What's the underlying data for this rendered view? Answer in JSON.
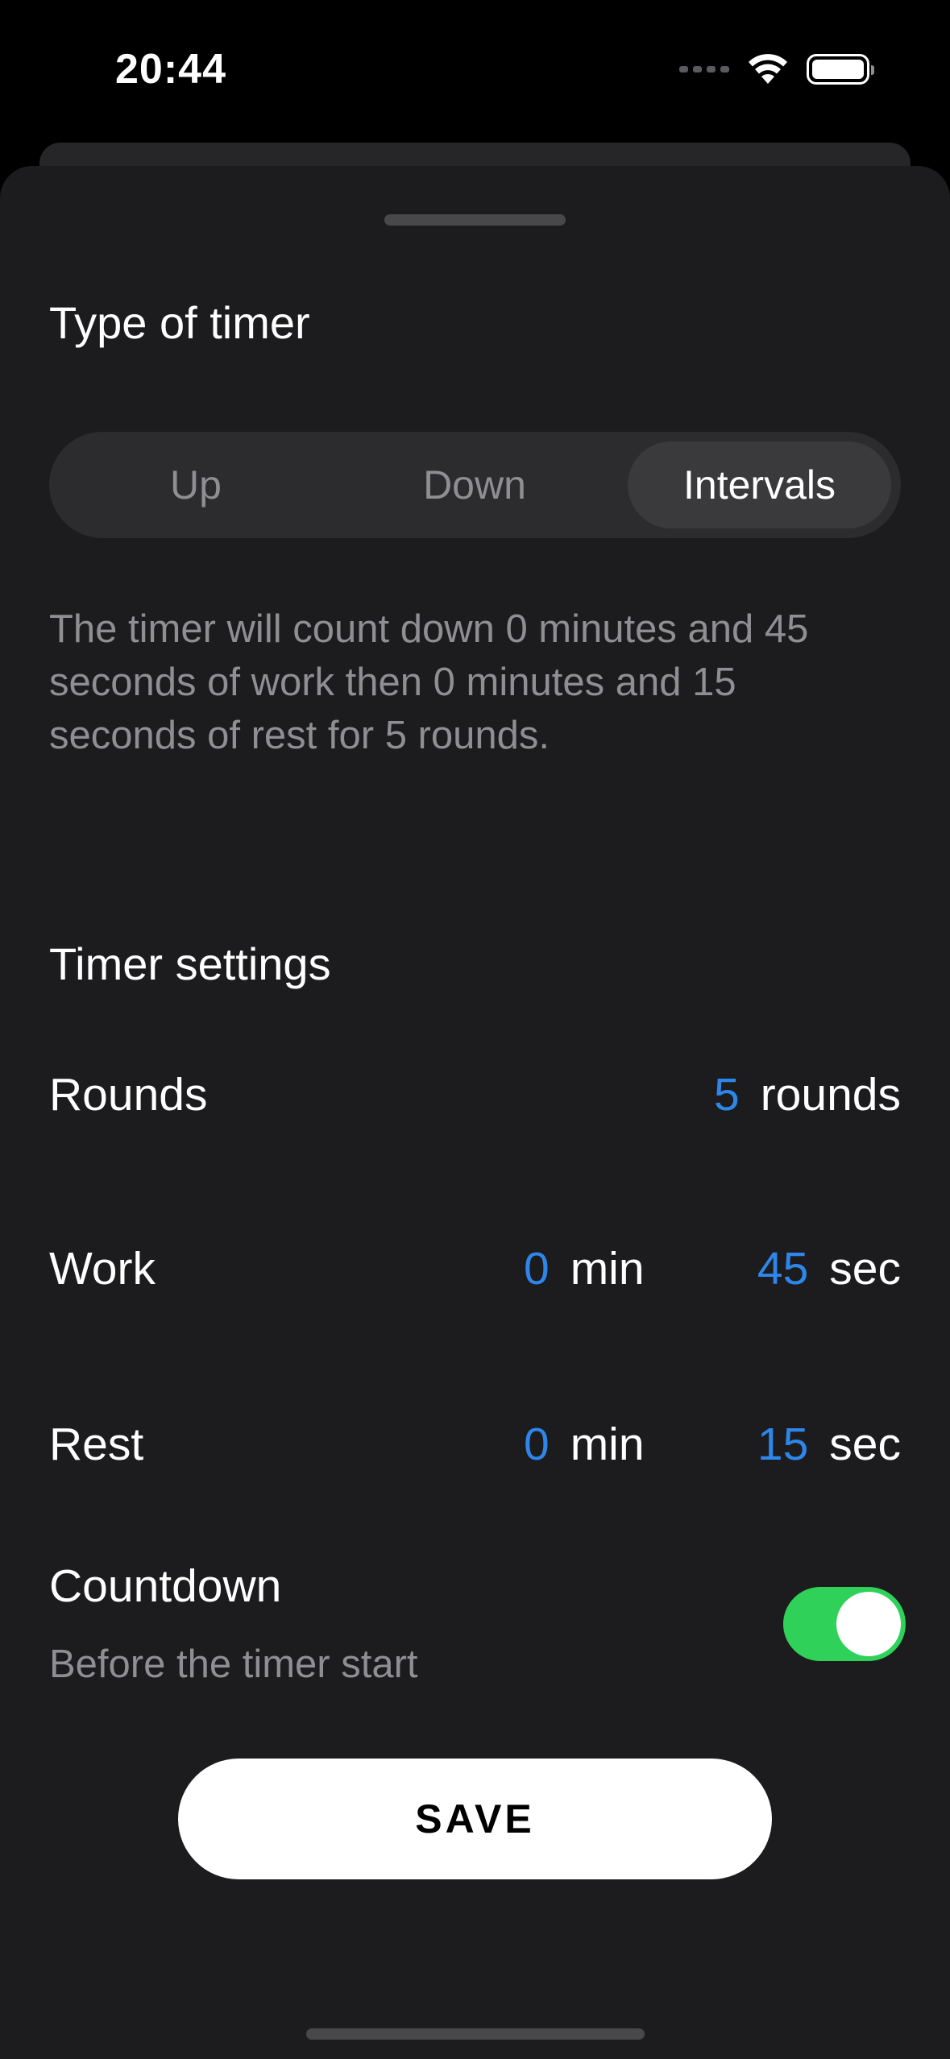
{
  "status_bar": {
    "time": "20:44",
    "icons": [
      "signal-dots-icon",
      "wifi-icon",
      "battery-icon"
    ]
  },
  "type_section": {
    "title": "Type of timer",
    "segments": [
      {
        "label": "Up",
        "selected": false
      },
      {
        "label": "Down",
        "selected": false
      },
      {
        "label": "Intervals",
        "selected": true
      }
    ],
    "description": "The timer will count down 0 minutes and 45 seconds of work then 0 minutes and 15 seconds of rest for 5 rounds."
  },
  "settings_section": {
    "title": "Timer settings",
    "rounds": {
      "label": "Rounds",
      "value": "5",
      "unit": "rounds"
    },
    "work": {
      "label": "Work",
      "min_value": "0",
      "min_unit": "min",
      "sec_value": "45",
      "sec_unit": "sec"
    },
    "rest": {
      "label": "Rest",
      "min_value": "0",
      "min_unit": "min",
      "sec_value": "15",
      "sec_unit": "sec"
    },
    "countdown": {
      "label": "Countdown",
      "subtitle": "Before the timer start",
      "enabled": true
    }
  },
  "save_label": "SAVE",
  "colors": {
    "accent_blue": "#2f86ea",
    "toggle_on": "#30d158",
    "sheet_bg": "#1c1c1e"
  }
}
